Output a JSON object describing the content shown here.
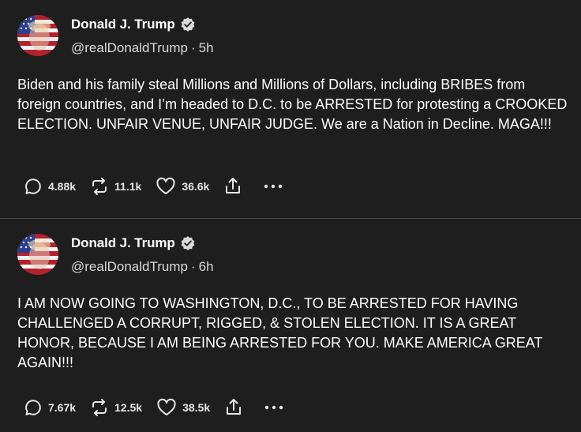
{
  "posts": [
    {
      "author": {
        "name": "Donald J. Trump",
        "handle": "@realDonaldTrump",
        "separator": "·",
        "time": "5h"
      },
      "text": "Biden and his family steal Millions and Millions of Dollars, including BRIBES from foreign countries, and I’m headed to D.C. to be ARRESTED for protesting a CROOKED ELECTION. UNFAIR VENUE, UNFAIR JUDGE. We are a Nation in Decline. MAGA!!!",
      "stats": {
        "replies": "4.88k",
        "reposts": "11.1k",
        "likes": "36.6k"
      },
      "icons": [
        "reply-icon",
        "repost-icon",
        "like-icon",
        "share-icon",
        "more-icon"
      ]
    },
    {
      "author": {
        "name": "Donald J. Trump",
        "handle": "@realDonaldTrump",
        "separator": "·",
        "time": "6h"
      },
      "text": "I AM NOW GOING TO WASHINGTON, D.C., TO BE ARRESTED FOR HAVING CHALLENGED A CORRUPT, RIGGED, & STOLEN ELECTION. IT IS A GREAT HONOR, BECAUSE I AM BEING ARRESTED FOR YOU. MAKE AMERICA GREAT AGAIN!!!",
      "stats": {
        "replies": "7.67k",
        "reposts": "12.5k",
        "likes": "38.5k"
      },
      "icons": [
        "reply-icon",
        "repost-icon",
        "like-icon",
        "share-icon",
        "more-icon"
      ]
    }
  ],
  "colors": {
    "background": "#1e1e1e",
    "text": "#ffffff",
    "muted": "#d9d9d9",
    "divider": "#4a4a4a"
  }
}
